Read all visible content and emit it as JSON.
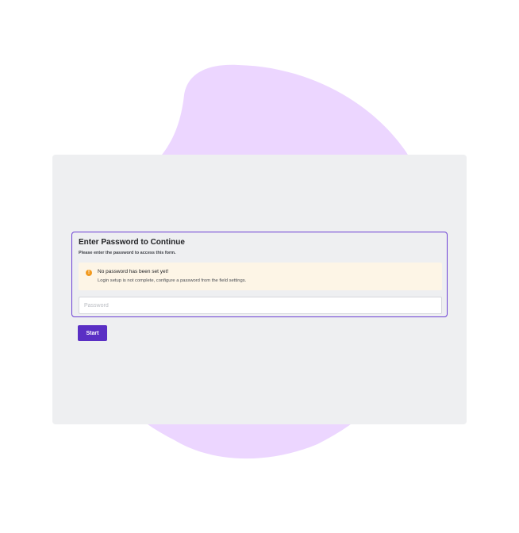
{
  "colors": {
    "blob": "#ecd6ff",
    "panel": "#eeeff1",
    "accent": "#6b3fd4",
    "button": "#5a2fc4",
    "notice_bg": "#fdf5e6",
    "notice_icon": "#f29a1f"
  },
  "login": {
    "title": "Enter Password to Continue",
    "subtitle": "Please enter the password to access this form."
  },
  "notice": {
    "icon": "alert-circle-icon",
    "icon_glyph": "!",
    "title": "No password has been set yet!",
    "text": "Login setup is not complete, configure a password from the field settings."
  },
  "password": {
    "placeholder": "Password",
    "value": ""
  },
  "start_button": {
    "label": "Start"
  }
}
